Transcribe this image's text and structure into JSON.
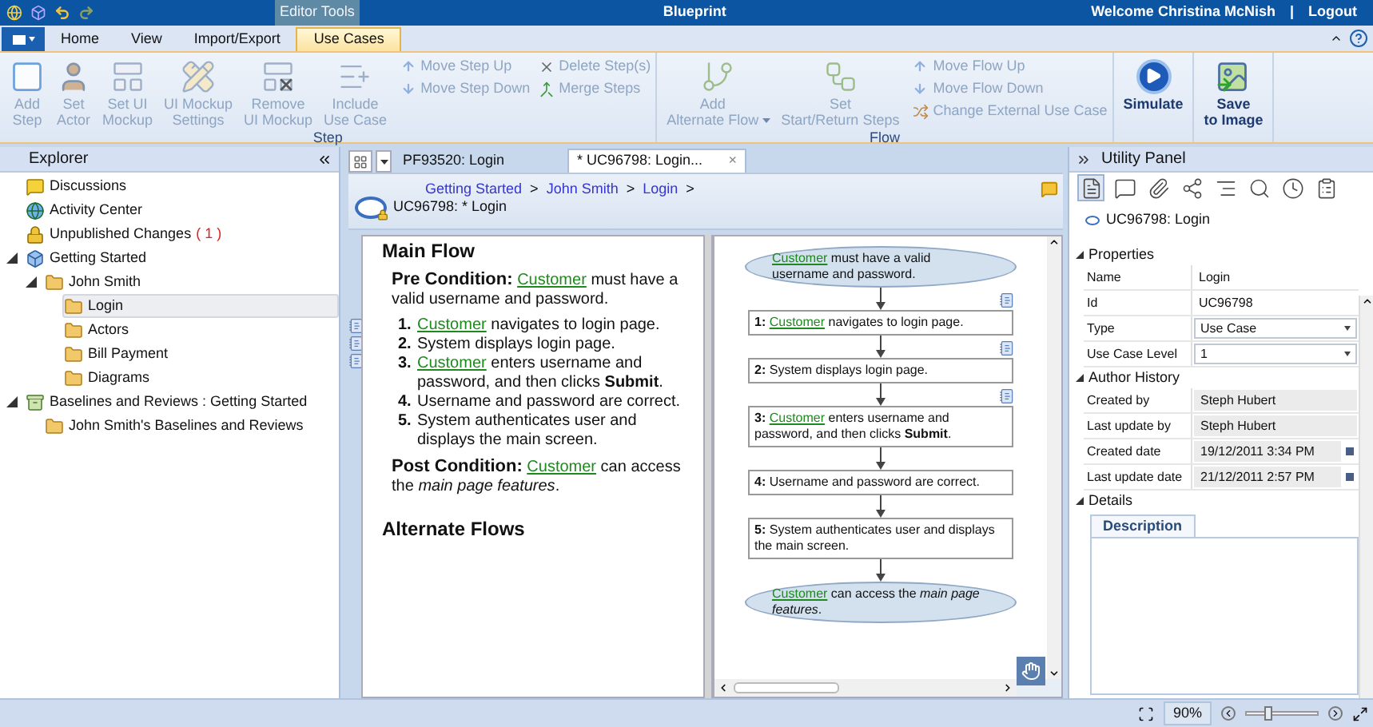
{
  "title_bar": {
    "contextual_group": "Editor Tools",
    "title": "Blueprint",
    "welcome": "Welcome Christina McNish",
    "separator": "|",
    "logout": "Logout"
  },
  "ribbon_tabs": [
    {
      "label": "Home",
      "selected": false
    },
    {
      "label": "View",
      "selected": false
    },
    {
      "label": "Import/Export",
      "selected": false
    },
    {
      "label": "Use Cases",
      "selected": true
    }
  ],
  "ribbon_groups": [
    {
      "label": "Step",
      "large_buttons": [
        {
          "label": "Add\nStep",
          "kind": "add-step",
          "disabled": true
        },
        {
          "label": "Set\nActor",
          "kind": "actor",
          "disabled": true
        },
        {
          "label": "Set UI\nMockup",
          "kind": "mockup",
          "disabled": true
        },
        {
          "label": "UI Mockup\nSettings",
          "kind": "mockup-settings",
          "disabled": true
        },
        {
          "label": "Remove\nUI Mockup",
          "kind": "remove-mockup",
          "disabled": true
        },
        {
          "label": "Include\nUse Case",
          "kind": "include",
          "disabled": true
        }
      ],
      "small_columns": [
        [
          {
            "label": "Move Step Up",
            "kind": "up",
            "disabled": true
          },
          {
            "label": "Move Step Down",
            "kind": "down",
            "disabled": true
          }
        ],
        [
          {
            "label": "Delete Step(s)",
            "kind": "delete",
            "disabled": true
          },
          {
            "label": "Merge Steps",
            "kind": "merge",
            "disabled": true
          }
        ]
      ]
    },
    {
      "label": "Flow",
      "large_buttons": [
        {
          "label": "Add\nAlternate Flow",
          "kind": "alternate",
          "disabled": true,
          "dropdown": true
        },
        {
          "label": "Set\nStart/Return Steps",
          "kind": "return",
          "disabled": true
        }
      ],
      "small_columns": [
        [
          {
            "label": "Move Flow Up",
            "kind": "up",
            "disabled": true
          },
          {
            "label": "Move Flow Down",
            "kind": "down",
            "disabled": true
          },
          {
            "label": "Change External Use Case",
            "kind": "external",
            "disabled": true
          }
        ]
      ]
    },
    {
      "large_buttons": [
        {
          "label": "Simulate",
          "kind": "simulate",
          "disabled": false
        }
      ]
    },
    {
      "large_buttons": [
        {
          "label": "Save\nto Image",
          "kind": "save-image",
          "disabled": false
        }
      ]
    }
  ],
  "explorer": {
    "title": "Explorer",
    "items": [
      {
        "label": "Discussions",
        "kind": "discussion",
        "selected": false
      },
      {
        "label": "Activity Center",
        "kind": "globe",
        "selected": false
      },
      {
        "label": "Unpublished Changes",
        "count": "( 1 )",
        "kind": "lock",
        "selected": false
      },
      {
        "label": "Getting Started",
        "kind": "project",
        "expanded": true,
        "selected": false,
        "children": [
          {
            "label": "John Smith",
            "kind": "folder",
            "expanded": true,
            "selected": false,
            "children": [
              {
                "label": "Login",
                "kind": "folder",
                "selected": true
              },
              {
                "label": "Actors",
                "kind": "folder",
                "selected": false
              },
              {
                "label": "Bill Payment",
                "kind": "folder",
                "selected": false
              },
              {
                "label": "Diagrams",
                "kind": "folder",
                "selected": false
              }
            ]
          }
        ]
      },
      {
        "label": "Baselines and Reviews : Getting Started",
        "kind": "baseline",
        "expanded": true,
        "selected": false,
        "children": [
          {
            "label": "John Smith's Baselines and Reviews",
            "kind": "folder",
            "selected": false
          }
        ]
      }
    ]
  },
  "document_tabs": [
    {
      "label": "PF93520: Login",
      "selected": false
    },
    {
      "label": "* UC96798: Login...",
      "selected": true,
      "close": "×"
    }
  ],
  "breadcrumb": [
    {
      "label": "Getting Started",
      "separator": ">"
    },
    {
      "label": "John Smith",
      "separator": ">"
    },
    {
      "label": "Login",
      "separator": ">"
    }
  ],
  "current_item": "UC96798: * Login",
  "main_flow": {
    "heading": "Main Flow",
    "pre_condition": {
      "label": "Pre Condition:",
      "link": "Customer",
      "text": "must have a valid username and password."
    },
    "steps": [
      {
        "number": "1.",
        "link": "Customer",
        "text": "navigates to login page.",
        "note": true
      },
      {
        "number": "2.",
        "text": "System displays login page.",
        "note": true
      },
      {
        "number": "3.",
        "link": "Customer",
        "text": "enters username and password, and then clicks **Submit**.",
        "note": true
      },
      {
        "number": "4.",
        "text": "Username and password are correct.",
        "note": false
      },
      {
        "number": "5.",
        "text": "System authenticates user and displays the main screen.",
        "note": false
      }
    ],
    "post_condition": {
      "label": "Post Condition:",
      "link": "Customer",
      "text": "can access the *main page features*."
    },
    "alternate_heading": "Alternate Flows"
  },
  "diagram": {
    "nodes": [
      {
        "kind": "ellipse",
        "link": "Customer",
        "text": "must have a valid username and password."
      },
      {
        "kind": "step",
        "number": "1:",
        "link": "Customer",
        "text": "navigates to login page.",
        "note": true
      },
      {
        "kind": "step",
        "number": "2:",
        "text": "System displays login page.",
        "note": true
      },
      {
        "kind": "step",
        "number": "3:",
        "link": "Customer",
        "text": "enters username and password, and then clicks **Submit**.",
        "note": true
      },
      {
        "kind": "step",
        "number": "4:",
        "text": "Username and password are correct.",
        "note": false
      },
      {
        "kind": "step",
        "number": "5:",
        "text": "System authenticates user and displays the main screen.",
        "note": false
      },
      {
        "kind": "ellipse",
        "link": "Customer",
        "text": "can access the *main page features*."
      }
    ]
  },
  "utility_panel": {
    "title": "Utility Panel",
    "tools": [
      {
        "kind": "properties",
        "selected": true
      },
      {
        "kind": "discussion",
        "selected": false
      },
      {
        "kind": "attachment",
        "selected": false
      },
      {
        "kind": "relationship",
        "selected": false
      },
      {
        "kind": "trace",
        "selected": false
      },
      {
        "kind": "search",
        "selected": false
      },
      {
        "kind": "history",
        "selected": false
      },
      {
        "kind": "review",
        "selected": false
      }
    ],
    "item": "UC96798: Login",
    "sections": [
      {
        "title": "Properties",
        "expanded": true,
        "rows": [
          {
            "label": "Name",
            "value": "Login",
            "kind": "text"
          },
          {
            "label": "Id",
            "value": "UC96798",
            "kind": "text"
          },
          {
            "label": "Type",
            "value": "Use Case",
            "kind": "select"
          },
          {
            "label": "Use Case Level",
            "value": "1",
            "kind": "select"
          }
        ]
      },
      {
        "title": "Author History",
        "expanded": true,
        "rows": [
          {
            "label": "Created by",
            "value": "Steph Hubert",
            "kind": "readonly"
          },
          {
            "label": "Last update by",
            "value": "Steph Hubert",
            "kind": "readonly"
          },
          {
            "label": "Created date",
            "value": "19/12/2011 3:34 PM",
            "kind": "date"
          },
          {
            "label": "Last update date",
            "value": "21/12/2011 2:57 PM",
            "kind": "date"
          }
        ]
      },
      {
        "title": "Details",
        "expanded": true,
        "tabs": [
          {
            "label": "Description",
            "selected": true
          }
        ]
      }
    ]
  },
  "status_bar": {
    "zoom": "90%",
    "zoom_slider": {
      "level": 0.3
    }
  }
}
